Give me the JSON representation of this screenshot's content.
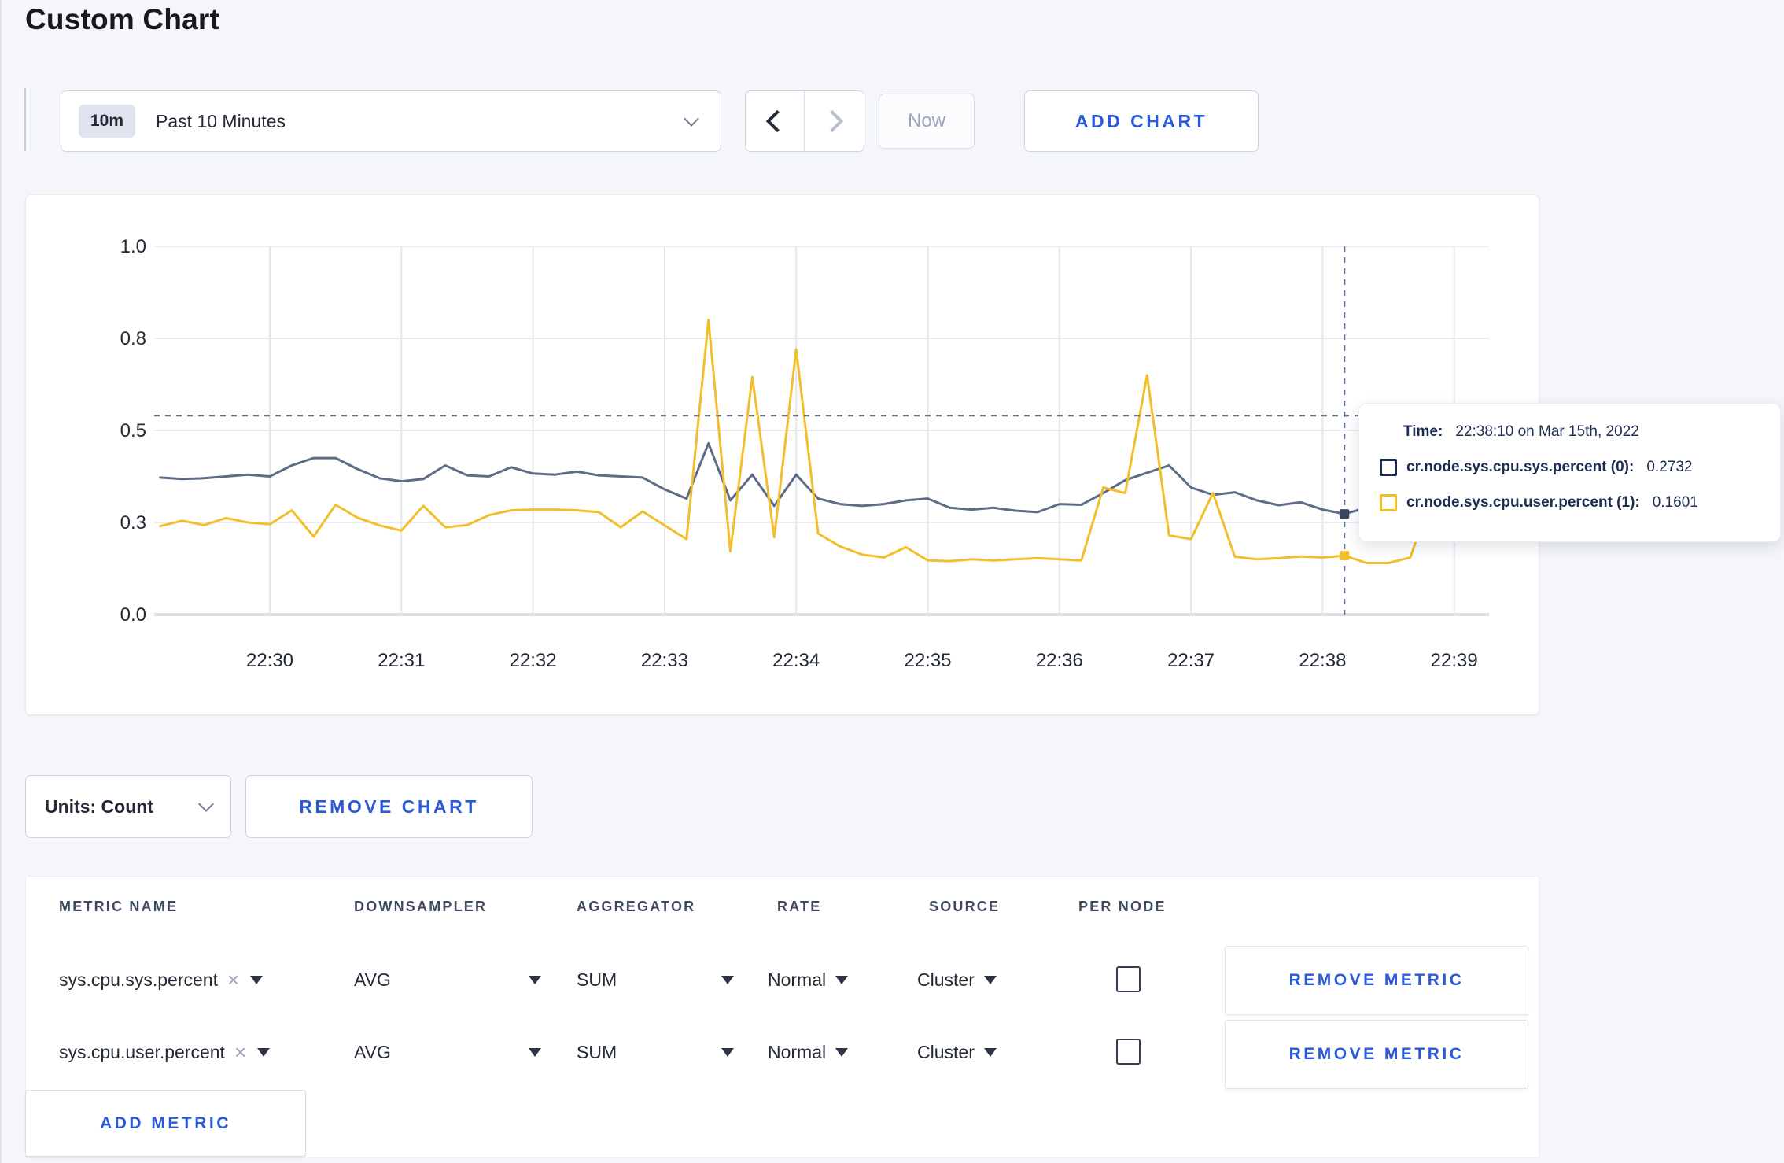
{
  "page": {
    "title": "Custom Chart"
  },
  "icons": {
    "close": "×"
  },
  "toolbar": {
    "time_window": {
      "badge": "10m",
      "label": "Past 10 Minutes"
    },
    "now_label": "Now",
    "add_chart_label": "ADD CHART"
  },
  "chart_controls": {
    "units_label": "Units: Count",
    "remove_chart_label": "REMOVE CHART"
  },
  "tooltip": {
    "time_label": "Time:",
    "time_value": "22:38:10 on Mar 15th, 2022",
    "entries": [
      {
        "label": "cr.node.sys.cpu.sys.percent (0):",
        "value": "0.2732",
        "color": "#1c2b4d"
      },
      {
        "label": "cr.node.sys.cpu.user.percent (1):",
        "value": "0.1601",
        "color": "#f2be2c"
      }
    ]
  },
  "chart_data": {
    "type": "line",
    "title": "",
    "xlabel": "",
    "ylabel": "",
    "ylim": [
      0,
      1
    ],
    "grid": true,
    "legend_position": "tooltip",
    "x_start_time": "22:29:10",
    "x_interval_seconds": 10,
    "x_tick_labels": [
      "22:30",
      "22:31",
      "22:32",
      "22:33",
      "22:34",
      "22:35",
      "22:36",
      "22:37",
      "22:38",
      "22:39"
    ],
    "y_ticks": {
      "values": [
        0,
        0.25,
        0.5,
        0.75,
        1.0
      ],
      "labels": [
        "0.0",
        "0.3",
        "0.5",
        "0.8",
        "1.0"
      ]
    },
    "crosshair": {
      "time": "22:38:10",
      "x_index": 54,
      "y_value": 0.54
    },
    "series": [
      {
        "name": "cr.node.sys.cpu.sys.percent (0)",
        "color": "#5f6c87",
        "values": [
          0.372,
          0.368,
          0.37,
          0.375,
          0.38,
          0.375,
          0.405,
          0.425,
          0.425,
          0.395,
          0.37,
          0.362,
          0.368,
          0.405,
          0.378,
          0.375,
          0.4,
          0.383,
          0.38,
          0.388,
          0.378,
          0.375,
          0.372,
          0.34,
          0.315,
          0.465,
          0.31,
          0.38,
          0.295,
          0.38,
          0.315,
          0.3,
          0.295,
          0.3,
          0.31,
          0.315,
          0.29,
          0.285,
          0.29,
          0.282,
          0.278,
          0.3,
          0.298,
          0.33,
          0.365,
          0.385,
          0.405,
          0.345,
          0.325,
          0.332,
          0.31,
          0.297,
          0.305,
          0.285,
          0.2732,
          0.29,
          0.295,
          0.3,
          0.31,
          0.298,
          0.3,
          0.305
        ]
      },
      {
        "name": "cr.node.sys.cpu.user.percent (1)",
        "color": "#f2be2c",
        "values": [
          0.24,
          0.255,
          0.243,
          0.262,
          0.25,
          0.245,
          0.283,
          0.212,
          0.298,
          0.263,
          0.242,
          0.228,
          0.295,
          0.237,
          0.243,
          0.27,
          0.283,
          0.285,
          0.285,
          0.283,
          0.278,
          0.237,
          0.28,
          0.242,
          0.205,
          0.8,
          0.172,
          0.645,
          0.21,
          0.72,
          0.22,
          0.185,
          0.163,
          0.155,
          0.183,
          0.147,
          0.145,
          0.15,
          0.147,
          0.15,
          0.153,
          0.15,
          0.147,
          0.345,
          0.33,
          0.65,
          0.215,
          0.205,
          0.33,
          0.157,
          0.15,
          0.153,
          0.158,
          0.155,
          0.1601,
          0.14,
          0.14,
          0.155,
          0.33,
          0.32,
          0.235,
          0.278
        ]
      }
    ]
  },
  "metrics_table": {
    "headers": [
      "METRIC NAME",
      "DOWNSAMPLER",
      "AGGREGATOR",
      "RATE",
      "SOURCE",
      "PER NODE"
    ],
    "rows": [
      {
        "metric_name": "sys.cpu.sys.percent",
        "downsampler": "AVG",
        "aggregator": "SUM",
        "rate": "Normal",
        "source": "Cluster",
        "per_node_checked": false,
        "remove_label": "REMOVE METRIC"
      },
      {
        "metric_name": "sys.cpu.user.percent",
        "downsampler": "AVG",
        "aggregator": "SUM",
        "rate": "Normal",
        "source": "Cluster",
        "per_node_checked": false,
        "remove_label": "REMOVE METRIC"
      }
    ],
    "add_metric_label": "ADD METRIC"
  },
  "colors": {
    "accent_blue": "#2a5adb",
    "series_sys": "#5f6c87",
    "series_user": "#f2be2c",
    "crosshair": "#5d7292",
    "gridline": "#e9ebee"
  }
}
